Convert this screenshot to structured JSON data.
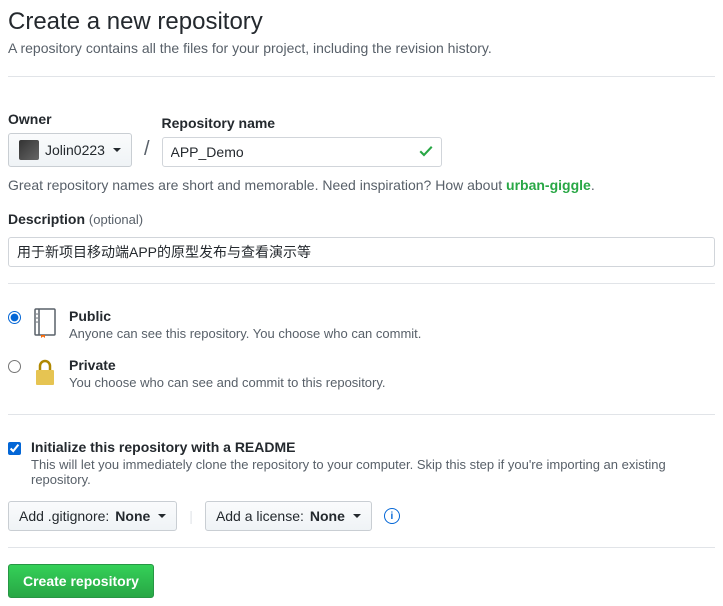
{
  "header": {
    "title": "Create a new repository",
    "subtitle": "A repository contains all the files for your project, including the revision history."
  },
  "owner": {
    "label": "Owner",
    "value": "Jolin0223"
  },
  "repo_name": {
    "label": "Repository name",
    "value": "APP_Demo"
  },
  "hint": {
    "prefix": "Great repository names are short and memorable. Need inspiration? How about ",
    "suggestion": "urban-giggle",
    "suffix": "."
  },
  "description": {
    "label": "Description",
    "optional": "(optional)",
    "value": "用于新项目移动端APP的原型发布与查看演示等"
  },
  "visibility": {
    "public": {
      "title": "Public",
      "note": "Anyone can see this repository. You choose who can commit."
    },
    "private": {
      "title": "Private",
      "note": "You choose who can see and commit to this repository."
    }
  },
  "init": {
    "title": "Initialize this repository with a README",
    "note": "This will let you immediately clone the repository to your computer. Skip this step if you're importing an existing repository."
  },
  "dropdowns": {
    "gitignore_prefix": "Add .gitignore: ",
    "gitignore_value": "None",
    "license_prefix": "Add a license: ",
    "license_value": "None"
  },
  "submit": {
    "label": "Create repository"
  }
}
